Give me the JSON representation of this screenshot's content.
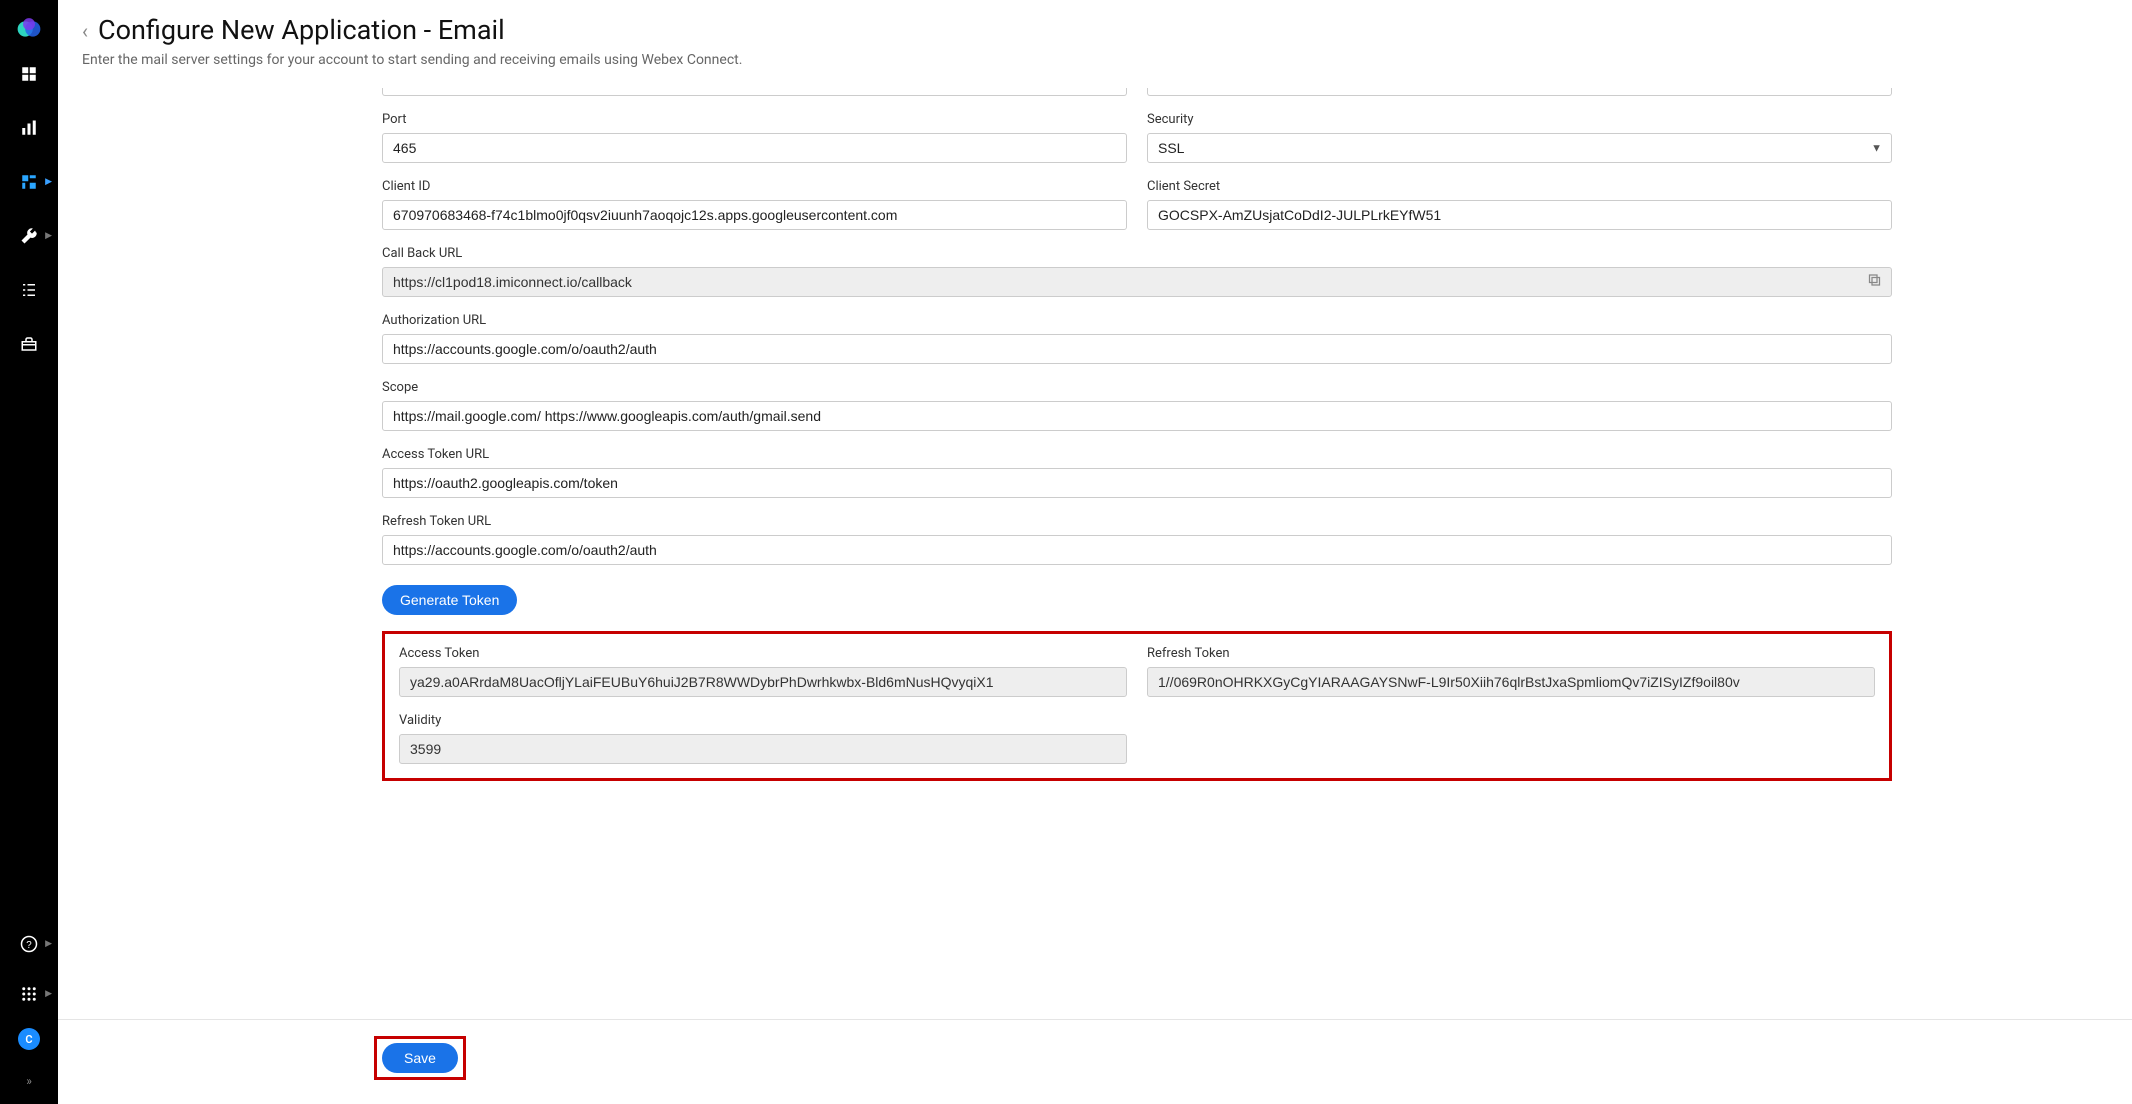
{
  "header": {
    "title": "Configure New Application - Email",
    "subtitle": "Enter the mail server settings for your account to start sending and receiving emails using Webex Connect."
  },
  "form": {
    "port_label": "Port",
    "port_value": "465",
    "security_label": "Security",
    "security_value": "SSL",
    "client_id_label": "Client ID",
    "client_id_value": "670970683468-f74c1blmo0jf0qsv2iuunh7aoqojc12s.apps.googleusercontent.com",
    "client_secret_label": "Client Secret",
    "client_secret_value": "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",
    "callback_label": "Call Back URL",
    "callback_value": "https://cl1pod18.imiconnect.io/callback",
    "auth_url_label": "Authorization URL",
    "auth_url_value": "https://accounts.google.com/o/oauth2/auth",
    "scope_label": "Scope",
    "scope_value": "https://mail.google.com/ https://www.googleapis.com/auth/gmail.send",
    "access_token_url_label": "Access Token URL",
    "access_token_url_value": "https://oauth2.googleapis.com/token",
    "refresh_token_url_label": "Refresh Token URL",
    "refresh_token_url_value": "https://accounts.google.com/o/oauth2/auth",
    "generate_token_label": "Generate Token",
    "access_token_label": "Access Token",
    "access_token_value": "ya29.a0ARrdaM8UacOfljYLaiFEUBuY6huiJ2B7R8WWDybrPhDwrhkwbx-Bld6mNusHQvyqiX1",
    "refresh_token_label": "Refresh Token",
    "refresh_token_value": "1//069R0nOHRKXGyCgYIARAAGAYSNwF-L9Ir50Xiih76qlrBstJxaSpmliomQv7iZISyIZf9oil80v",
    "validity_label": "Validity",
    "validity_value": "3599"
  },
  "footer": {
    "save_label": "Save"
  },
  "sidebar": {
    "avatar_letter": "C"
  }
}
